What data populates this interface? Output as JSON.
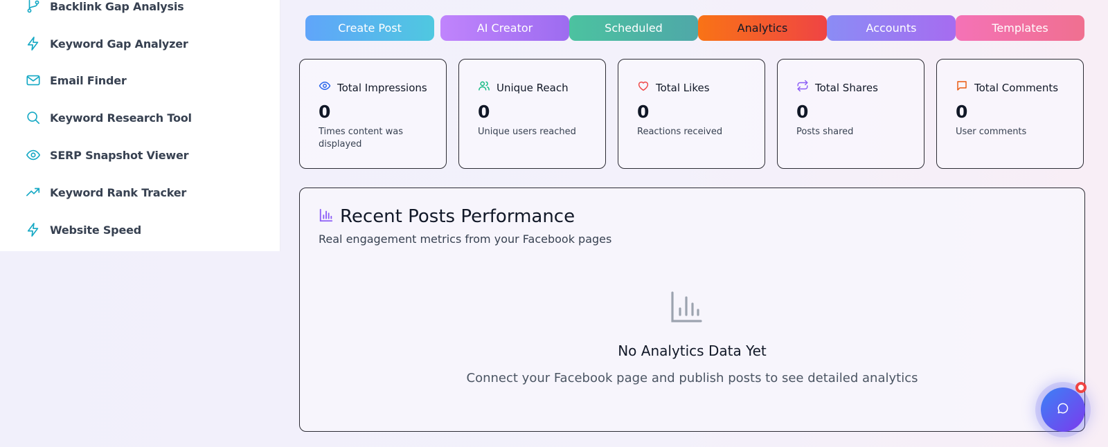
{
  "sidebar": {
    "items": [
      {
        "label": "Backlink Gap Analysis",
        "icon": "branch-icon"
      },
      {
        "label": "Keyword Gap Analyzer",
        "icon": "lightning-icon"
      },
      {
        "label": "Email Finder",
        "icon": "mail-icon"
      },
      {
        "label": "Keyword Research Tool",
        "icon": "search-icon"
      },
      {
        "label": "SERP Snapshot Viewer",
        "icon": "eye-icon"
      },
      {
        "label": "Keyword Rank Tracker",
        "icon": "trending-up-icon"
      },
      {
        "label": "Website Speed",
        "icon": "lightning-icon"
      }
    ],
    "icon_color": "#14a8c4"
  },
  "tabs": [
    {
      "label": "Create Post",
      "gradient": [
        "#60a5fa",
        "#4fc8e0"
      ]
    },
    {
      "label": "AI Creator",
      "gradient": [
        "#c084fc",
        "#9d6cf0"
      ]
    },
    {
      "label": "Scheduled",
      "gradient": [
        "#4cc2a0",
        "#4fa8a8"
      ]
    },
    {
      "label": "Analytics",
      "gradient": [
        "#f97316",
        "#ef4444"
      ],
      "active": true
    },
    {
      "label": "Accounts",
      "gradient": [
        "#8b8cf5",
        "#a66cf0"
      ]
    },
    {
      "label": "Templates",
      "gradient": [
        "#f472b6",
        "#f07090"
      ]
    }
  ],
  "stats": [
    {
      "title": "Total Impressions",
      "value": "0",
      "description": "Times content was displayed",
      "icon": "eye-icon",
      "color": "#2563eb"
    },
    {
      "title": "Unique Reach",
      "value": "0",
      "description": "Unique users reached",
      "icon": "users-icon",
      "color": "#10b981"
    },
    {
      "title": "Total Likes",
      "value": "0",
      "description": "Reactions received",
      "icon": "heart-icon",
      "color": "#ef4444"
    },
    {
      "title": "Total Shares",
      "value": "0",
      "description": "Posts shared",
      "icon": "repeat-icon",
      "color": "#8b5cf6"
    },
    {
      "title": "Total Comments",
      "value": "0",
      "description": "User comments",
      "icon": "comment-icon",
      "color": "#ea580c"
    }
  ],
  "performance": {
    "title": "Recent Posts Performance",
    "subtitle": "Real engagement metrics from your Facebook pages",
    "icon": "bar-chart-icon",
    "empty_title": "No Analytics Data Yet",
    "empty_subtitle": "Connect your Facebook page and publish posts to see detailed analytics"
  },
  "chat": {
    "icon": "chat-icon",
    "has_notification": true
  }
}
